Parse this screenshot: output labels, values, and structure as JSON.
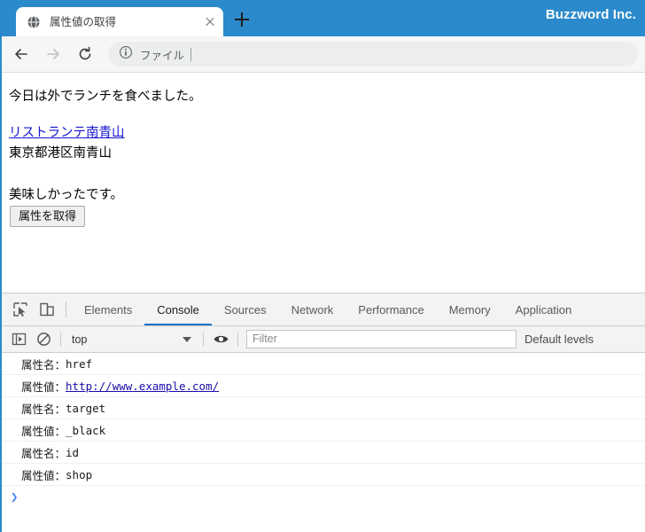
{
  "titlebar": {
    "tab": {
      "favicon_icon": "globe-icon",
      "title": "属性値の取得",
      "close_icon": "close-icon"
    },
    "newtab_icon": "plus-icon",
    "brand": "Buzzword Inc."
  },
  "toolbar": {
    "back_icon": "arrow-left-icon",
    "forward_icon": "arrow-right-icon",
    "reload_icon": "reload-icon",
    "omnibox": {
      "info_icon": "info-circle-icon",
      "text": "ファイル"
    }
  },
  "page": {
    "paragraph_1": "今日は外でランチを食べました。",
    "link_text": "リストランテ南青山",
    "address": "東京都港区南青山",
    "paragraph_2": "美味しかったです。",
    "button_label": "属性を取得",
    "cursor_icon": "mouse-pointer-icon"
  },
  "devtools": {
    "inspect_icon": "inspect-element-icon",
    "device_icon": "device-toolbar-icon",
    "tabs": [
      {
        "label": "Elements",
        "active": false
      },
      {
        "label": "Console",
        "active": true
      },
      {
        "label": "Sources",
        "active": false
      },
      {
        "label": "Network",
        "active": false
      },
      {
        "label": "Performance",
        "active": false
      },
      {
        "label": "Memory",
        "active": false
      },
      {
        "label": "Application",
        "active": false
      }
    ],
    "console_toolbar": {
      "sidebar_icon": "console-sidebar-icon",
      "clear_icon": "clear-console-icon",
      "context_value": "top",
      "context_caret_icon": "chevron-down-icon",
      "eye_icon": "eye-icon",
      "filter_placeholder": "Filter",
      "filter_value": "",
      "levels_label": "Default levels"
    },
    "console_rows": [
      {
        "label": "属性名：",
        "value": "href",
        "is_link": false
      },
      {
        "label": "属性値：",
        "value": "http://www.example.com/",
        "is_link": true
      },
      {
        "label": "属性名：",
        "value": "target",
        "is_link": false
      },
      {
        "label": "属性値：",
        "value": "_black",
        "is_link": false
      },
      {
        "label": "属性名：",
        "value": "id",
        "is_link": false
      },
      {
        "label": "属性値：",
        "value": "shop",
        "is_link": false
      }
    ],
    "prompt_caret": "❯"
  },
  "colors": {
    "brand_blue": "#2b8acb",
    "tab_active_underline": "#1a73c8",
    "link_blue": "#1a0dab",
    "page_link_blue": "#1414ce",
    "prompt_blue": "#4285f4"
  }
}
